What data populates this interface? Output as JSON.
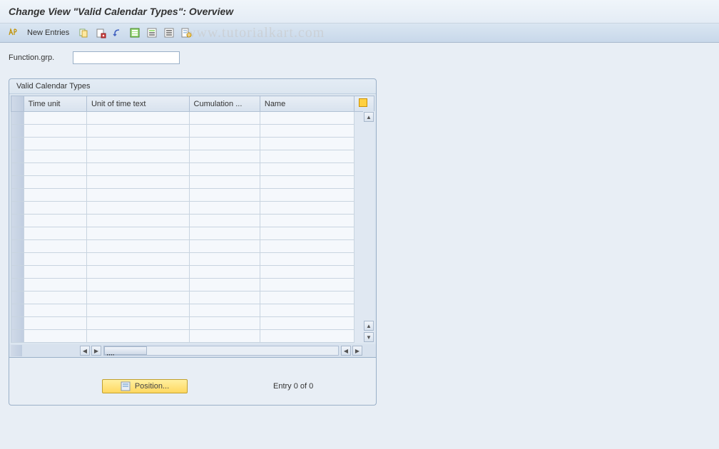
{
  "title": "Change View \"Valid Calendar Types\": Overview",
  "toolbar": {
    "new_entries": "New Entries"
  },
  "watermark": "www.tutorialkart.com",
  "field": {
    "label": "Function.grp.",
    "value": ""
  },
  "panel": {
    "title": "Valid Calendar Types",
    "columns": [
      "Time unit",
      "Unit of time text",
      "Cumulation ...",
      "Name"
    ]
  },
  "footer": {
    "position_label": "Position...",
    "entry_text": "Entry 0 of 0"
  }
}
